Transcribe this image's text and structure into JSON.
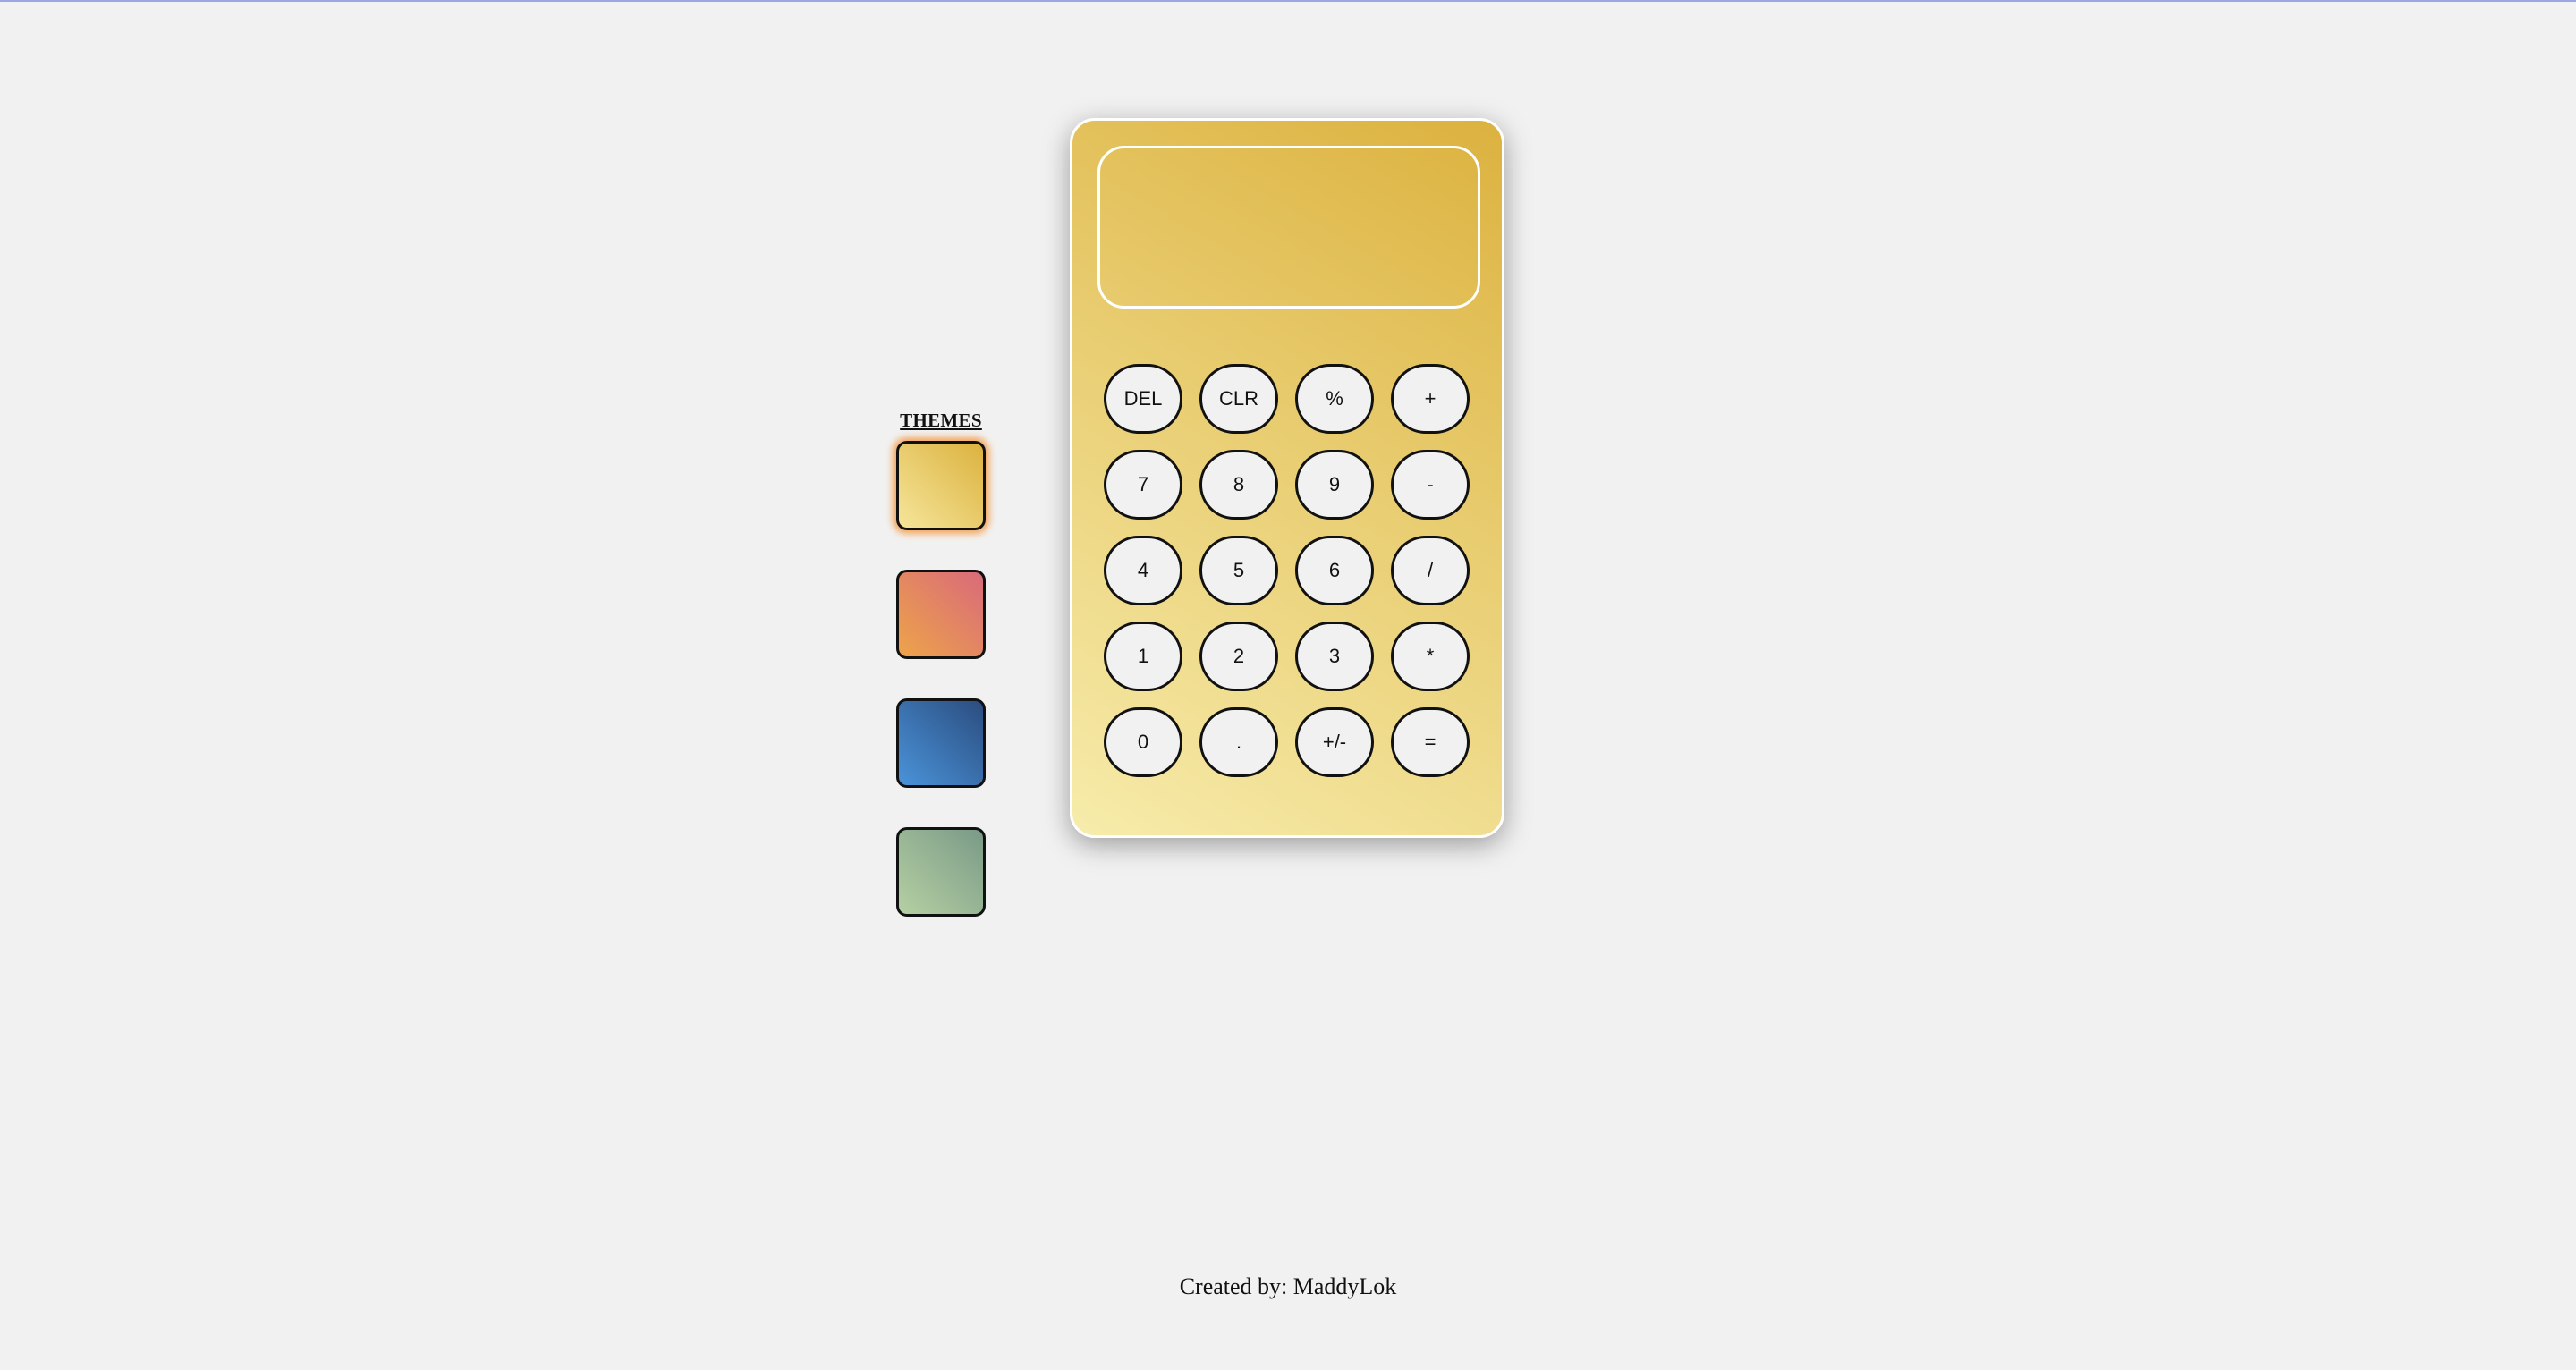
{
  "themes": {
    "title": "THEMES",
    "swatches": [
      {
        "name": "gold",
        "from": "#f5e59a",
        "to": "#dcb23f",
        "active": true
      },
      {
        "name": "sunset",
        "from": "#eda44a",
        "to": "#d96a7a",
        "active": false
      },
      {
        "name": "ocean",
        "from": "#4a93d9",
        "to": "#2b4d80",
        "active": false
      },
      {
        "name": "sage",
        "from": "#b5d0a3",
        "to": "#7a9a87",
        "active": false
      }
    ]
  },
  "calculator": {
    "display_value": "",
    "body_colors": {
      "from": "#f7ecab",
      "to": "#dcb23f"
    },
    "keys": [
      "DEL",
      "CLR",
      "%",
      "+",
      "7",
      "8",
      "9",
      "-",
      "4",
      "5",
      "6",
      "/",
      "1",
      "2",
      "3",
      "*",
      "0",
      ".",
      "+/-",
      "="
    ]
  },
  "footer": {
    "text": "Created by: MaddyLok"
  }
}
